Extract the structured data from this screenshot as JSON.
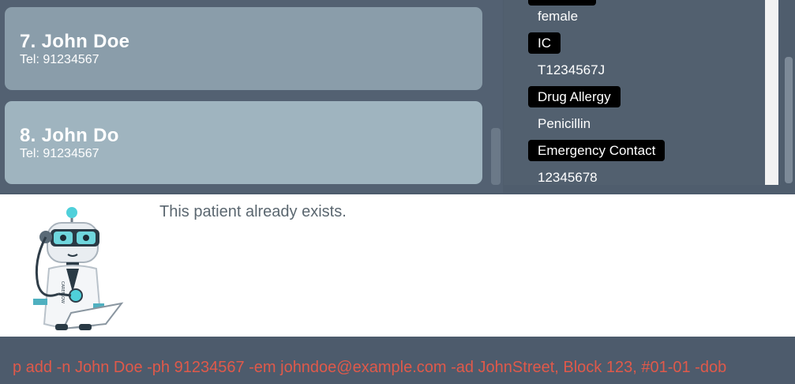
{
  "patients": [
    {
      "name": "7.  John Doe",
      "tel": "Tel: 91234567"
    },
    {
      "name": "8.  John Do",
      "tel": "Tel: 91234567"
    }
  ],
  "detail": {
    "gender_value": "female",
    "ic_label": "IC",
    "ic_value": "T1234567J",
    "allergy_label": "Drug Allergy",
    "allergy_value": "Penicillin",
    "emergency_label": "Emergency Contact",
    "emergency_value": "12345678"
  },
  "result_message": "This patient already exists.",
  "command_input": "p add -n John Doe -ph 91234567 -em johndoe@example.com -ad JohnStreet, Block 123, #01-01 -dob",
  "colors": {
    "card_7": "#8a9daa",
    "card_8": "#9fb4bf",
    "command_text": "#e0594a"
  }
}
